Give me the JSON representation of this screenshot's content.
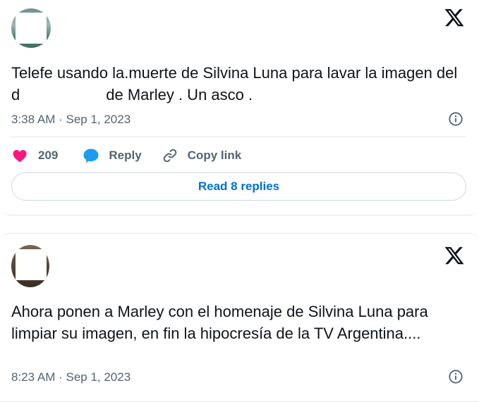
{
  "tweets": [
    {
      "text_before_redaction": "Telefe usando la.muerte de Silvina Luna para lavar la imagen del d",
      "text_after_redaction": "de Marley . Un asco .",
      "timestamp": "3:38 AM · Sep 1, 2023",
      "likes": "209",
      "reply_label": "Reply",
      "copy_link_label": "Copy link",
      "read_replies_label": "Read 8 replies"
    },
    {
      "text": "Ahora ponen a Marley con el homenaje de Silvina Luna para limpiar su imagen, en fin la hipocresía de la TV Argentina....",
      "timestamp": "8:23 AM · Sep 1, 2023"
    }
  ],
  "icons": {
    "logo": "x-logo-icon",
    "info": "info-icon",
    "like": "heart-icon",
    "reply": "speech-bubble-icon",
    "copy": "link-icon"
  },
  "colors": {
    "text": "#0f1419",
    "secondary": "#536471",
    "like": "#f91880",
    "reply": "#1d9bf0",
    "link_button": "#006fd6",
    "border": "#cfd9de"
  }
}
